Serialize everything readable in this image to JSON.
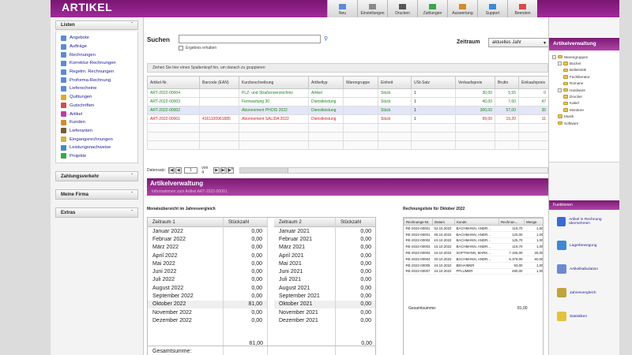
{
  "app": {
    "title": "ARTIKEL",
    "accent": "#9b2a93"
  },
  "toolbar": [
    "Neu",
    "Einstellungen",
    "Drucken",
    "Zahlungen",
    "Auswertung",
    "Support",
    "Beenden"
  ],
  "sidebar": {
    "listen_header": "Listen",
    "items": [
      {
        "label": "Angebote",
        "icon": "document-icon",
        "color": "#5b8bd8"
      },
      {
        "label": "Aufträge",
        "icon": "order-icon",
        "color": "#5b8bd8"
      },
      {
        "label": "Rechnungen",
        "icon": "invoice-icon",
        "color": "#5b8bd8"
      },
      {
        "label": "Korrektur-Rechnungen",
        "icon": "correction-icon",
        "color": "#5b8bd8"
      },
      {
        "label": "Regelm. Rechnungen",
        "icon": "recurring-icon",
        "color": "#5b8bd8"
      },
      {
        "label": "Proforma-Rechnung",
        "icon": "proforma-icon",
        "color": "#5b8bd8"
      },
      {
        "label": "Lieferscheine",
        "icon": "delivery-icon",
        "color": "#5b8bd8"
      },
      {
        "label": "Quittungen",
        "icon": "receipt-icon",
        "color": "#e1a82a"
      },
      {
        "label": "Gutschriften",
        "icon": "credit-icon",
        "color": "#d94a4a"
      },
      {
        "label": "Artikel",
        "icon": "article-icon",
        "color": "#c23aa6"
      },
      {
        "label": "Kunden",
        "icon": "customers-icon",
        "color": "#d68a2a"
      },
      {
        "label": "Lieferanten",
        "icon": "supplier-icon",
        "color": "#7a5a3a"
      },
      {
        "label": "Eingangsrechnungen",
        "icon": "incoming-invoice-icon",
        "color": "#d6b23a"
      },
      {
        "label": "Leistungsnachweise",
        "icon": "service-record-icon",
        "color": "#3a8ad6"
      },
      {
        "label": "Projekte",
        "icon": "projects-icon",
        "color": "#3aa64a"
      }
    ],
    "sections": [
      "Zahlungsverkehr",
      "Meine Firma",
      "Extras"
    ]
  },
  "search": {
    "label": "Suchen",
    "keep_label": "Ergebnis erhalten",
    "value": ""
  },
  "zeitraum": {
    "label": "Zeitraum",
    "value": "aktuelles Jahr"
  },
  "grid": {
    "group_hint": "Ziehen Sie hier einen Spaltenkopf hin, um danach zu gruppieren",
    "columns": [
      "Artikel-Nr.",
      "Barcode (EAN)",
      "Kurzbeschreibung",
      "Artikeltyp",
      "Warengruppe",
      "Einheit",
      "USt-Satz",
      "Verkaufspreis",
      "Brutto",
      "Einkaufspreis"
    ],
    "rows": [
      {
        "nr": "ART-2022-00004",
        "ean": "",
        "desc": "PLZ- und Straßenverzeichnis",
        "typ": "Artikel",
        "wg": "",
        "unit": "Stück",
        "ust": "1",
        "vk": "30,00",
        "brutto": "5,55",
        "ek": "0",
        "color": "g"
      },
      {
        "nr": "ART-2022-00003",
        "ean": "",
        "desc": "Fernwartung 30",
        "typ": "Dienstleistung",
        "wg": "",
        "unit": "Stück",
        "ust": "1",
        "vk": "40,00",
        "brutto": "7,60",
        "ek": "47",
        "color": "g"
      },
      {
        "nr": "ART-2022-00002",
        "ean": "",
        "desc": "Abonnement PHOIS 2022",
        "typ": "Dienstleistung",
        "wg": "",
        "unit": "Stück",
        "ust": "1",
        "vk": "300,00",
        "brutto": "57,00",
        "ek": "35",
        "color": "g"
      },
      {
        "nr": "ART-2022-00001",
        "ean": "4161100961885",
        "desc": "Abonnement SALIDA 2022",
        "typ": "Dienstleistung",
        "wg": "",
        "unit": "Stück",
        "ust": "1",
        "vk": "99,00",
        "brutto": "19,20",
        "ek": "11",
        "color": "r"
      }
    ],
    "pager": {
      "label": "Datensatz:",
      "current": "1",
      "of": "von 4"
    }
  },
  "subhead": {
    "title": "Artikelverwaltung",
    "subtitle": "Informationen zum Artikel ART-2022-00001"
  },
  "monthly": {
    "title": "Monatsübersicht im Jahresvergleich",
    "headers": [
      "Zeitraum 1",
      "Stückzahl",
      "Zeitraum 2",
      "Stückzahl"
    ],
    "p1": [
      "Januar 2022",
      "Februar 2022",
      "März 2022",
      "April 2022",
      "Mai 2022",
      "Juni 2022",
      "Juli 2022",
      "August 2022",
      "September 2022",
      "Oktober 2022",
      "November 2022",
      "Dezember 2022"
    ],
    "q1": [
      "0,00",
      "0,00",
      "0,00",
      "0,00",
      "0,00",
      "0,00",
      "0,00",
      "0,00",
      "0,00",
      "81,00",
      "0,00",
      "0,00"
    ],
    "p2": [
      "Januar 2021",
      "Februar 2021",
      "März 2021",
      "April 2021",
      "Mai 2021",
      "Juni 2021",
      "Juli 2021",
      "August 2021",
      "September 2021",
      "Oktober 2021",
      "November 2021",
      "Dezember 2021"
    ],
    "q2": [
      "0,00",
      "0,00",
      "0,00",
      "0,00",
      "0,00",
      "0,00",
      "0,00",
      "0,00",
      "0,00",
      "0,00",
      "0,00",
      "0,00"
    ],
    "sum_label": "Gesamtsumme:",
    "sum1": "81,00",
    "sum2": "0,00"
  },
  "invoices": {
    "title": "Rechnungsliste für Oktober 2022",
    "headers": [
      "Rechnungs-Nr.",
      "Datum",
      "Kunde",
      "Rechnun...",
      "Menge"
    ],
    "rows": [
      [
        "RE-2022-00001",
        "02.10.2022",
        "BACHMANN, ANDR...",
        "119,70",
        "1,00"
      ],
      [
        "RE-2022-00001",
        "05.10.2022",
        "BACHMANN, ANDR...",
        "120,00",
        "1,00"
      ],
      [
        "RE-2022-00002",
        "10.10.2022",
        "BACHMANN, ANDR...",
        "125,70",
        "1,00"
      ],
      [
        "RE-2022-00003",
        "15.10.2022",
        "BACHMANN, ANDR...",
        "119,70",
        "1,00"
      ],
      [
        "RE-2022-00003",
        "16.10.2022",
        "SOFTMANN, MARK...",
        "7.155,00",
        "25,00"
      ],
      [
        "RE-2022-00004",
        "20.10.2022",
        "BACHMANN, ANDR...",
        "5.378,00",
        "50,00"
      ],
      [
        "RE-2022-00005",
        "24.10.2022",
        "BEHAIMER",
        "93,00",
        "1,00"
      ],
      [
        "RE-2022-00007",
        "24.10.2022",
        "PFLUMER",
        "490,00",
        "1,00"
      ]
    ],
    "sum_label": "Gesamtsumme:",
    "sum": "81,00"
  },
  "rightpanel": {
    "header": "Artikelverwaltung",
    "tree": [
      {
        "label": "Warengruppen",
        "level": 0,
        "pm": "−"
      },
      {
        "label": "Bücher",
        "level": 1,
        "pm": "−"
      },
      {
        "label": "Belletristik",
        "level": 2,
        "pm": ""
      },
      {
        "label": "Fachliteratur",
        "level": 2,
        "pm": ""
      },
      {
        "label": "Romane",
        "level": 2,
        "pm": ""
      },
      {
        "label": "Hardware",
        "level": 1,
        "pm": "−"
      },
      {
        "label": "Drucker",
        "level": 2,
        "pm": ""
      },
      {
        "label": "Kabel",
        "level": 2,
        "pm": ""
      },
      {
        "label": "Monitore",
        "level": 2,
        "pm": ""
      },
      {
        "label": "Musik",
        "level": 1,
        "pm": ""
      },
      {
        "label": "Software",
        "level": 1,
        "pm": ""
      }
    ],
    "actions_header": "Funktionen",
    "actions": [
      {
        "label": "Artikel in Rechnung übernehmen",
        "color": "#3a6ad6"
      },
      {
        "label": "Lagerbewegung",
        "color": "#3a8ad6"
      },
      {
        "label": "Artikelkalkulation",
        "color": "#6a8ad6"
      },
      {
        "label": "Jahresvergleich",
        "color": "#c2a23a"
      },
      {
        "label": "Statistiken",
        "color": "#e2c23a"
      }
    ]
  }
}
